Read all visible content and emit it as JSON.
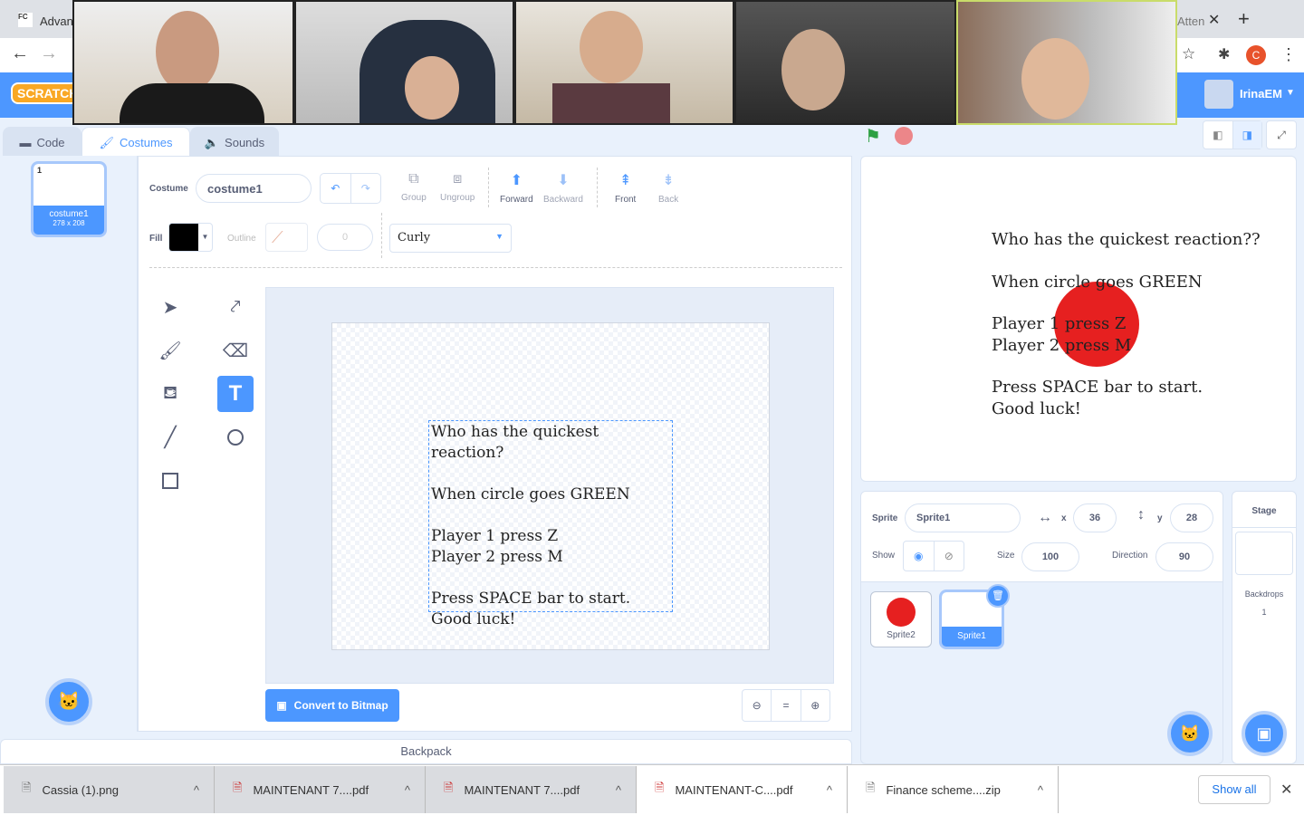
{
  "browser": {
    "tab_left": "Advan",
    "tab_right": "Atten",
    "favicon": "FC",
    "profile_initial": "C"
  },
  "scratch": {
    "logo": "SCRATCH",
    "username": "IrinaEM"
  },
  "video_call": {
    "tiles": 5
  },
  "tabs": [
    {
      "label": "Code"
    },
    {
      "label": "Costumes"
    },
    {
      "label": "Sounds"
    }
  ],
  "costume_list": [
    {
      "index": "1",
      "name": "costume1",
      "size": "278 x 208"
    }
  ],
  "editor": {
    "costume_label": "Costume",
    "costume_name": "costume1",
    "toolbar": {
      "group": "Group",
      "ungroup": "Ungroup",
      "forward": "Forward",
      "backward": "Backward",
      "front": "Front",
      "back": "Back"
    },
    "fill_label": "Fill",
    "fill_color": "#000000",
    "outline_label": "Outline",
    "outline_width": "0",
    "font": "Curly",
    "convert_button": "Convert to Bitmap",
    "canvas_text": [
      "Who has  the quickest reaction?",
      "When circle goes GREEN",
      "Player 1 press Z",
      "Player 2 press M",
      "Press SPACE bar to start.",
      "Good luck!"
    ]
  },
  "stage": {
    "text": [
      "Who has  the quickest reaction??",
      "When circle goes GREEN",
      "Player 1 press Z",
      "Player 2 press M",
      "Press SPACE bar to start.",
      "Good luck!"
    ]
  },
  "sprite_info": {
    "sprite_label": "Sprite",
    "sprite_name": "Sprite1",
    "x_label": "x",
    "x": "36",
    "y_label": "y",
    "y": "28",
    "show_label": "Show",
    "size_label": "Size",
    "size": "100",
    "direction_label": "Direction",
    "direction": "90"
  },
  "sprites": [
    {
      "name": "Sprite2"
    },
    {
      "name": "Sprite1"
    }
  ],
  "stage_panel": {
    "title": "Stage",
    "backdrops_label": "Backdrops",
    "backdrops_count": "1"
  },
  "backpack": "Backpack",
  "downloads": {
    "items": [
      "Cassia (1).png",
      "MAINTENANT 7....pdf",
      "MAINTENANT 7....pdf",
      "MAINTENANT-C....pdf",
      "Finance scheme....zip"
    ],
    "show_all": "Show all"
  },
  "colors": {
    "accent": "#4c97ff",
    "menubar": "#4d97ff",
    "red": "#e62020"
  }
}
